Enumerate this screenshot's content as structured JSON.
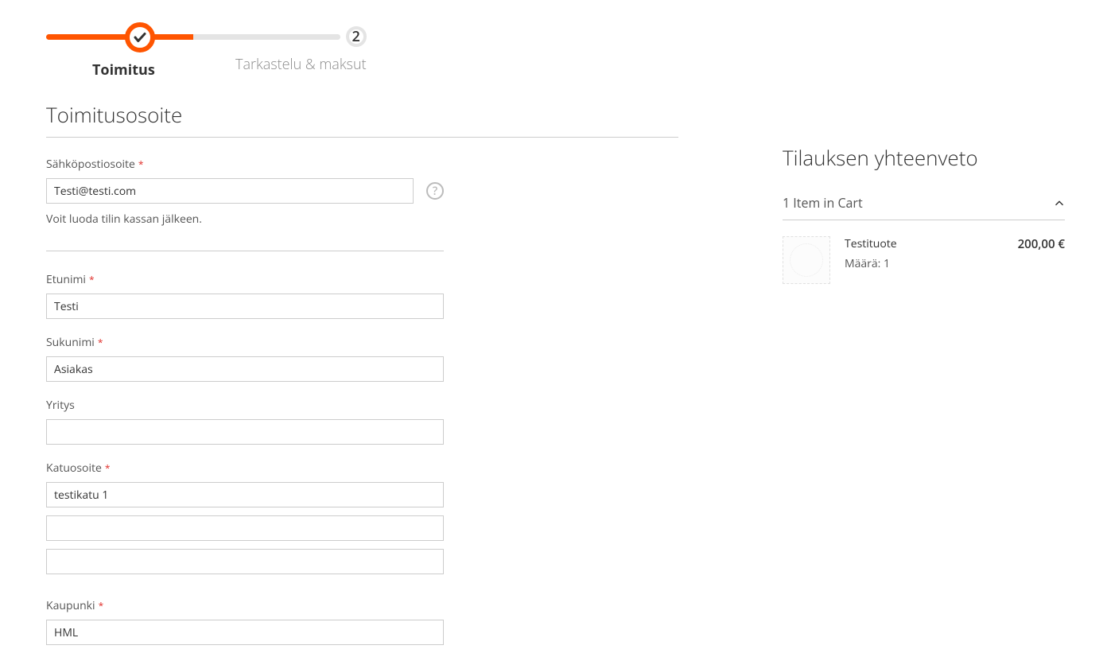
{
  "progress": {
    "step1": {
      "label": "Toimitus",
      "icon": "check"
    },
    "step2": {
      "label": "Tarkastelu & maksut",
      "number": "2"
    }
  },
  "shipping": {
    "title": "Toimitusosoite",
    "email": {
      "label": "Sähköpostiosoite",
      "value": "Testi@testi.com",
      "note": "Voit luoda tilin kassan jälkeen.",
      "help": "?"
    },
    "firstname": {
      "label": "Etunimi",
      "value": "Testi"
    },
    "lastname": {
      "label": "Sukunimi",
      "value": "Asiakas"
    },
    "company": {
      "label": "Yritys",
      "value": ""
    },
    "street": {
      "label": "Katuosoite",
      "line1": "testikatu 1",
      "line2": "",
      "line3": ""
    },
    "city": {
      "label": "Kaupunki",
      "value": "HML"
    }
  },
  "summary": {
    "title": "Tilauksen yhteenveto",
    "cart_label": "1 Item in Cart",
    "items": [
      {
        "name": "Testituote",
        "qty_label": "Määrä:",
        "qty": "1",
        "price": "200,00 €"
      }
    ]
  }
}
